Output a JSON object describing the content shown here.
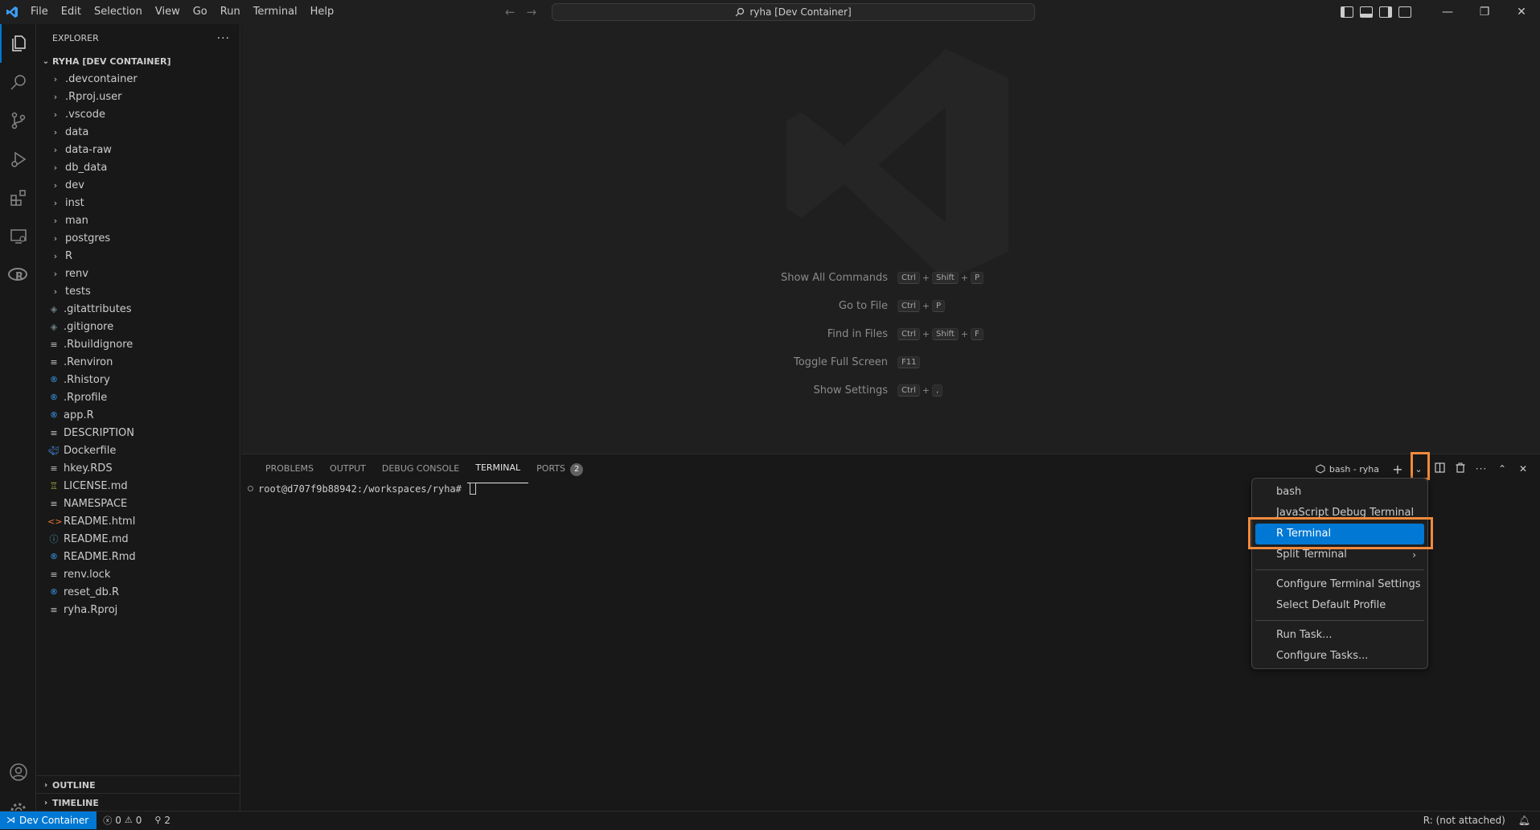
{
  "title_bar": {
    "menu": [
      "File",
      "Edit",
      "Selection",
      "View",
      "Go",
      "Run",
      "Terminal",
      "Help"
    ],
    "command_center": "ryha [Dev Container]"
  },
  "explorer": {
    "header": "EXPLORER",
    "root": "RYHA [DEV CONTAINER]",
    "items": [
      {
        "name": ".devcontainer",
        "type": "folder",
        "icon": "chevron-right-icon"
      },
      {
        "name": ".Rproj.user",
        "type": "folder",
        "icon": "chevron-right-icon"
      },
      {
        "name": ".vscode",
        "type": "folder",
        "icon": "chevron-right-icon"
      },
      {
        "name": "data",
        "type": "folder",
        "icon": "chevron-right-icon"
      },
      {
        "name": "data-raw",
        "type": "folder",
        "icon": "chevron-right-icon"
      },
      {
        "name": "db_data",
        "type": "folder",
        "icon": "chevron-right-icon"
      },
      {
        "name": "dev",
        "type": "folder",
        "icon": "chevron-right-icon"
      },
      {
        "name": "inst",
        "type": "folder",
        "icon": "chevron-right-icon"
      },
      {
        "name": "man",
        "type": "folder",
        "icon": "chevron-right-icon"
      },
      {
        "name": "postgres",
        "type": "folder",
        "icon": "chevron-right-icon"
      },
      {
        "name": "R",
        "type": "folder",
        "icon": "chevron-right-icon"
      },
      {
        "name": "renv",
        "type": "folder",
        "icon": "chevron-right-icon"
      },
      {
        "name": "tests",
        "type": "folder",
        "icon": "chevron-right-icon"
      },
      {
        "name": ".gitattributes",
        "type": "file",
        "icon": "git-icon"
      },
      {
        "name": ".gitignore",
        "type": "file",
        "icon": "git-icon"
      },
      {
        "name": ".Rbuildignore",
        "type": "file",
        "icon": "lines-icon"
      },
      {
        "name": ".Renviron",
        "type": "file",
        "icon": "lines-icon"
      },
      {
        "name": ".Rhistory",
        "type": "file",
        "icon": "r-file-icon"
      },
      {
        "name": ".Rprofile",
        "type": "file",
        "icon": "r-file-icon"
      },
      {
        "name": "app.R",
        "type": "file",
        "icon": "r-file-icon"
      },
      {
        "name": "DESCRIPTION",
        "type": "file",
        "icon": "lines-icon"
      },
      {
        "name": "Dockerfile",
        "type": "file",
        "icon": "docker-icon"
      },
      {
        "name": "hkey.RDS",
        "type": "file",
        "icon": "lines-icon"
      },
      {
        "name": "LICENSE.md",
        "type": "file",
        "icon": "license-icon"
      },
      {
        "name": "NAMESPACE",
        "type": "file",
        "icon": "lines-icon"
      },
      {
        "name": "README.html",
        "type": "file",
        "icon": "html-icon"
      },
      {
        "name": "README.md",
        "type": "file",
        "icon": "info-icon"
      },
      {
        "name": "README.Rmd",
        "type": "file",
        "icon": "r-file-icon"
      },
      {
        "name": "renv.lock",
        "type": "file",
        "icon": "lines-icon"
      },
      {
        "name": "reset_db.R",
        "type": "file",
        "icon": "r-file-icon"
      },
      {
        "name": "ryha.Rproj",
        "type": "file",
        "icon": "lines-icon"
      }
    ],
    "outline": "OUTLINE",
    "timeline": "TIMELINE"
  },
  "welcome_shortcuts": [
    {
      "label": "Show All Commands",
      "keys": [
        "Ctrl",
        "Shift",
        "P"
      ]
    },
    {
      "label": "Go to File",
      "keys": [
        "Ctrl",
        "P"
      ]
    },
    {
      "label": "Find in Files",
      "keys": [
        "Ctrl",
        "Shift",
        "F"
      ]
    },
    {
      "label": "Toggle Full Screen",
      "keys": [
        "F11"
      ]
    },
    {
      "label": "Show Settings",
      "keys": [
        "Ctrl",
        ","
      ]
    }
  ],
  "panel": {
    "tabs": [
      "PROBLEMS",
      "OUTPUT",
      "DEBUG CONSOLE",
      "TERMINAL",
      "PORTS"
    ],
    "active_tab": "TERMINAL",
    "ports_badge": "2",
    "terminal_name": "bash - ryha",
    "prompt": "root@d707f9b88942:/workspaces/ryha#"
  },
  "terminal_dropdown": {
    "group1": [
      "bash",
      "JavaScript Debug Terminal",
      "R Terminal",
      "Split Terminal"
    ],
    "selected": "R Terminal",
    "group2": [
      "Configure Terminal Settings",
      "Select Default Profile"
    ],
    "group3": [
      "Run Task...",
      "Configure Tasks..."
    ]
  },
  "status_bar": {
    "remote": "Dev Container",
    "errors": "0",
    "warnings": "0",
    "ports": "2",
    "r_status": "R: (not attached)"
  },
  "colors": {
    "accent": "#0078d4",
    "highlight_box": "#f08a3c"
  }
}
